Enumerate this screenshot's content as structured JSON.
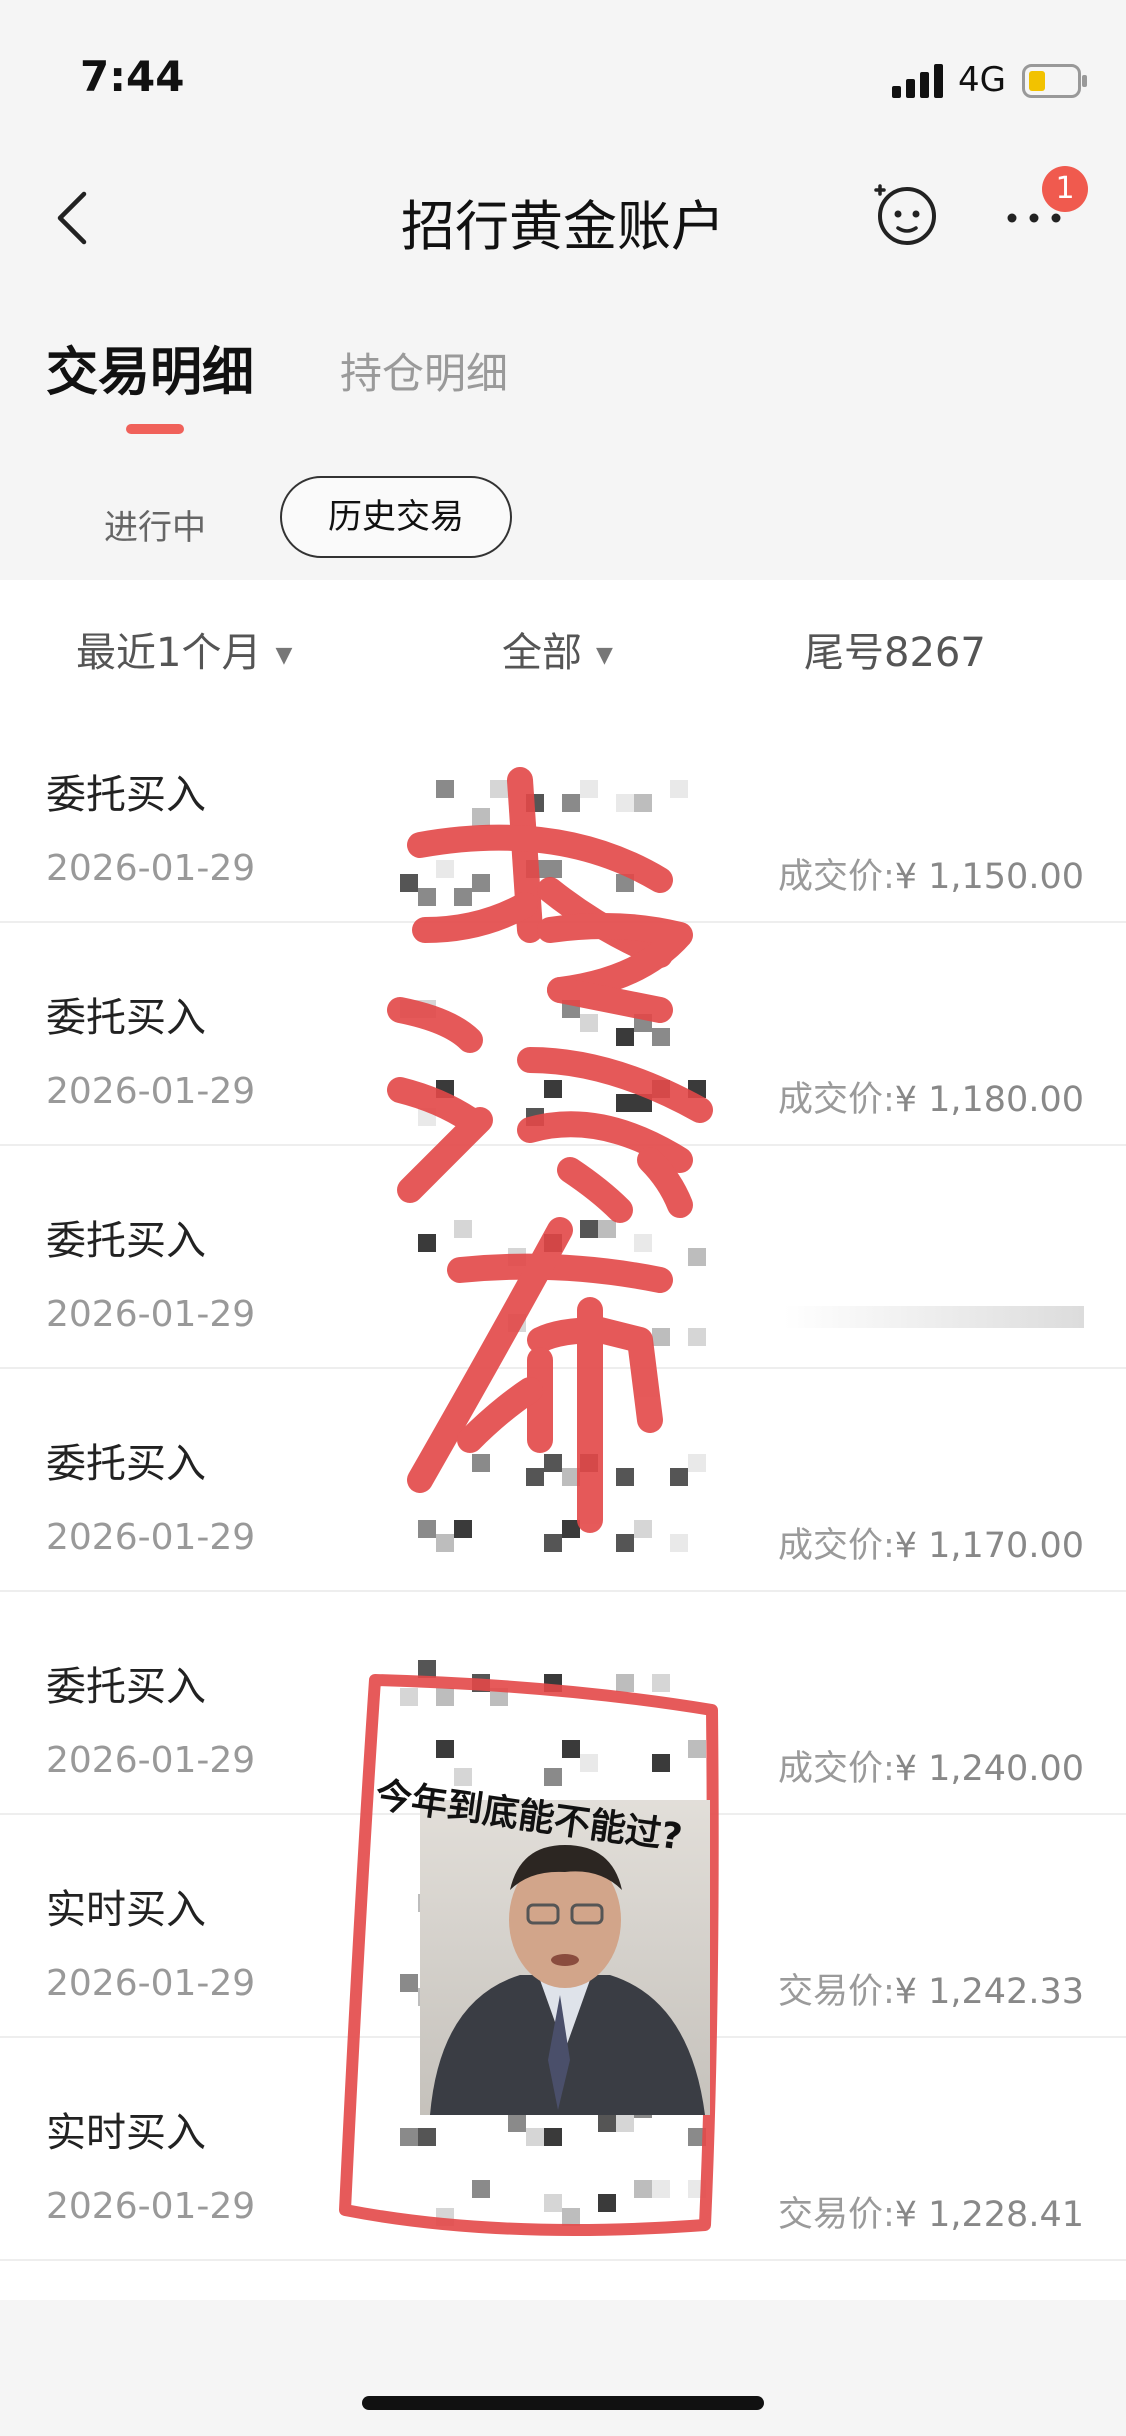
{
  "status_bar": {
    "time": "7:44",
    "network": "4G"
  },
  "nav": {
    "title": "招行黄金账户",
    "badge_count": "1"
  },
  "tabs": {
    "main": "交易明细",
    "secondary": "持仓明细"
  },
  "subtabs": {
    "ongoing": "进行中",
    "history": "历史交易"
  },
  "filters": {
    "period": "最近1个月",
    "category": "全部",
    "account_tail": "尾号8267"
  },
  "transactions": [
    {
      "type": "委托买入",
      "date": "2026-01-29",
      "price_label": "成交价:",
      "price": "¥ 1,150.00"
    },
    {
      "type": "委托买入",
      "date": "2026-01-29",
      "price_label": "成交价:",
      "price": "¥ 1,180.00"
    },
    {
      "type": "委托买入",
      "date": "2026-01-29",
      "price_label": "",
      "price": ""
    },
    {
      "type": "委托买入",
      "date": "2026-01-29",
      "price_label": "成交价:",
      "price": "¥ 1,170.00"
    },
    {
      "type": "委托买入",
      "date": "2026-01-29",
      "price_label": "成交价:",
      "price": "¥ 1,240.00"
    },
    {
      "type": "实时买入",
      "date": "2026-01-29",
      "price_label": "交易价:",
      "price": "¥ 1,242.33"
    },
    {
      "type": "实时买入",
      "date": "2026-01-29",
      "price_label": "交易价:",
      "price": "¥ 1,228.41"
    }
  ],
  "overlay": {
    "meme_caption": "今年到底能不能过?"
  },
  "colors": {
    "accent": "#f0615a",
    "ink": "#e34848"
  }
}
